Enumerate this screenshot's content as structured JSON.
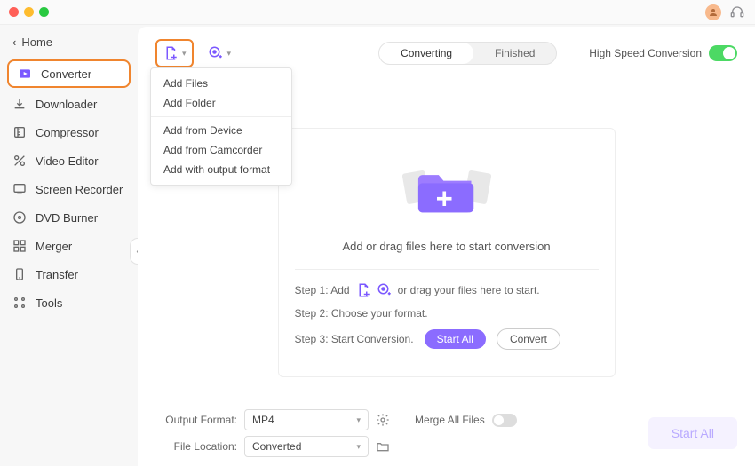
{
  "sidebar": {
    "home": "Home",
    "items": [
      {
        "label": "Converter"
      },
      {
        "label": "Downloader"
      },
      {
        "label": "Compressor"
      },
      {
        "label": "Video Editor"
      },
      {
        "label": "Screen Recorder"
      },
      {
        "label": "DVD Burner"
      },
      {
        "label": "Merger"
      },
      {
        "label": "Transfer"
      },
      {
        "label": "Tools"
      }
    ]
  },
  "tabs": {
    "converting": "Converting",
    "finished": "Finished"
  },
  "high_speed_label": "High Speed Conversion",
  "dropdown": {
    "add_files": "Add Files",
    "add_folder": "Add Folder",
    "add_from_device": "Add from Device",
    "add_from_camcorder": "Add from Camcorder",
    "add_with_output_format": "Add with output format"
  },
  "content": {
    "drop_text": "Add or drag files here to start conversion",
    "step1_prefix": "Step 1: Add",
    "step1_suffix": "or drag your files here to start.",
    "step2": "Step 2: Choose your format.",
    "step3": "Step 3: Start Conversion.",
    "start_all_pill": "Start  All",
    "convert_pill": "Convert"
  },
  "bottom": {
    "output_format_label": "Output Format:",
    "output_format_value": "MP4",
    "file_location_label": "File Location:",
    "file_location_value": "Converted",
    "merge_label": "Merge All Files",
    "start_all": "Start All"
  }
}
